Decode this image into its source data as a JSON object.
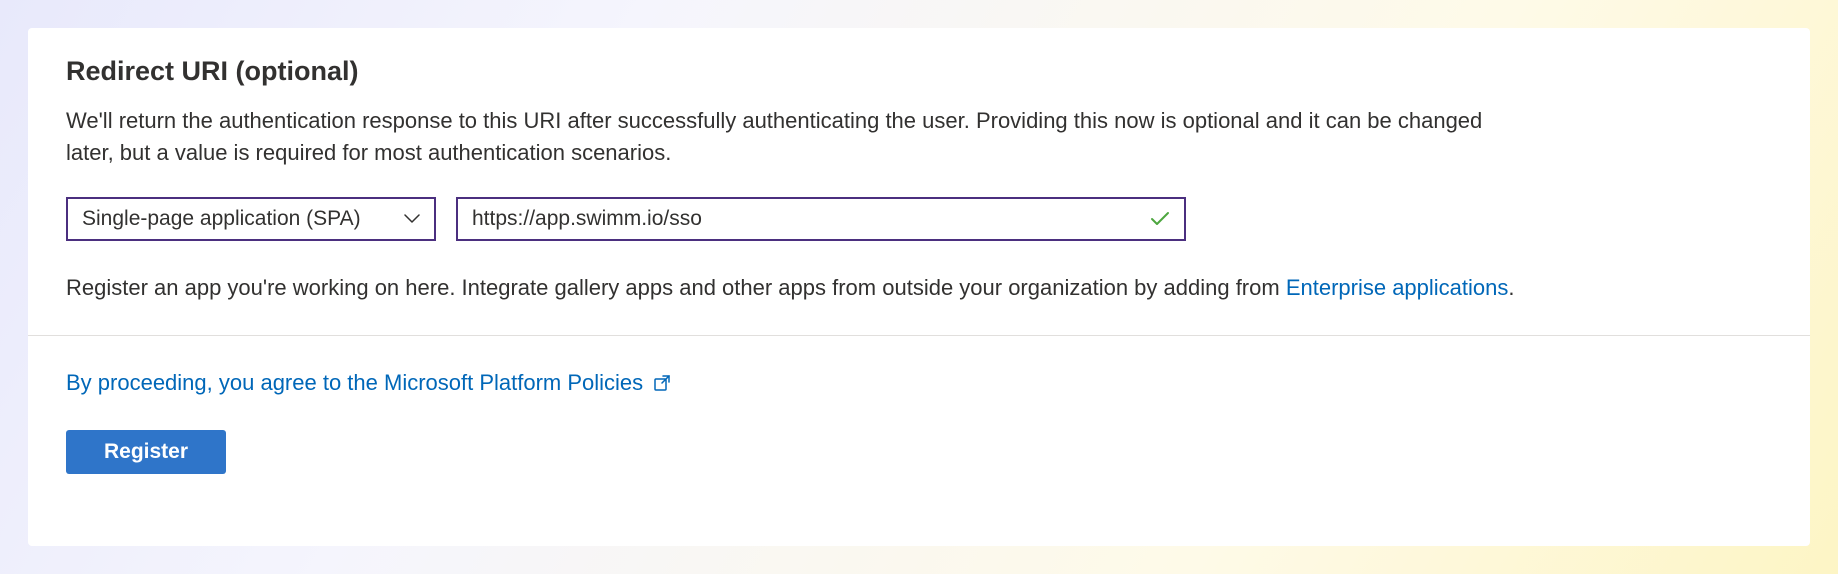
{
  "section": {
    "title": "Redirect URI (optional)",
    "description": "We'll return the authentication response to this URI after successfully authenticating the user. Providing this now is optional and it can be changed later, but a value is required for most authentication scenarios."
  },
  "platform_select": {
    "value": "Single-page application (SPA)"
  },
  "uri_input": {
    "value": "https://app.swimm.io/sso"
  },
  "hint": {
    "prefix": "Register an app you're working on here. Integrate gallery apps and other apps from outside your organization by adding from ",
    "link_text": "Enterprise applications",
    "suffix": "."
  },
  "policies": {
    "link_text": "By proceeding, you agree to the Microsoft Platform Policies"
  },
  "actions": {
    "register_label": "Register"
  },
  "colors": {
    "link": "#0067b8",
    "border_focus": "#4b2f7f",
    "primary_button": "#2f75c9",
    "checkmark": "#4da63f"
  }
}
